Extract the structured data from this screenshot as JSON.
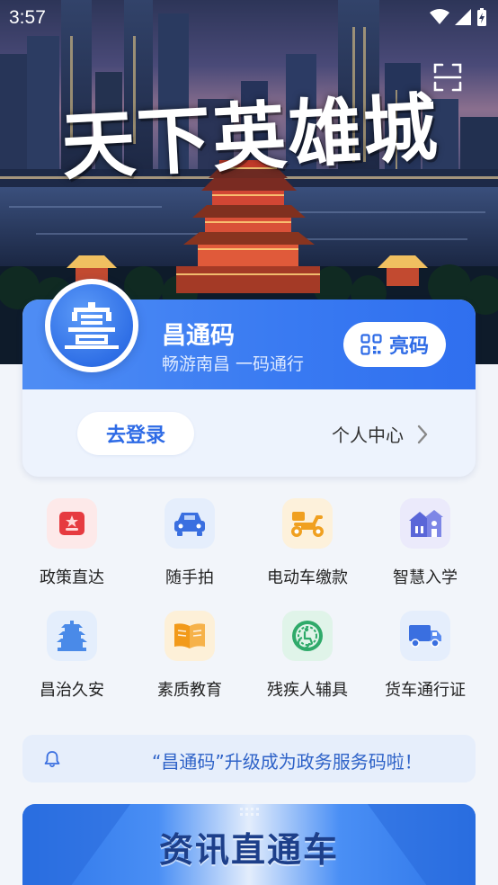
{
  "status_bar": {
    "time": "3:57"
  },
  "hero": {
    "title": "天下英雄城"
  },
  "card": {
    "app_name": "昌通码",
    "slogan": "畅游南昌 一码通行",
    "show_code_label": "亮码",
    "login_label": "去登录",
    "personal_center_label": "个人中心"
  },
  "services": [
    {
      "label": "政策直达",
      "icon": "policy-icon",
      "color": "#e63b40"
    },
    {
      "label": "随手拍",
      "icon": "car-photo-icon",
      "color": "#3a6fe0"
    },
    {
      "label": "电动车缴款",
      "icon": "scooter-icon",
      "color": "#f0a020"
    },
    {
      "label": "智慧入学",
      "icon": "school-icon",
      "color": "#5a66d8"
    },
    {
      "label": "昌治久安",
      "icon": "pagoda-icon",
      "color": "#4a8ae8"
    },
    {
      "label": "素质教育",
      "icon": "book-icon",
      "color": "#f29a1a"
    },
    {
      "label": "残疾人辅具",
      "icon": "accessibility-icon",
      "color": "#2faa6a"
    },
    {
      "label": "货车通行证",
      "icon": "truck-icon",
      "color": "#3a6fe0"
    }
  ],
  "notice": {
    "text": "“昌通码”升级成为政务服务码啦！"
  },
  "news": {
    "title": "资讯直通车"
  }
}
